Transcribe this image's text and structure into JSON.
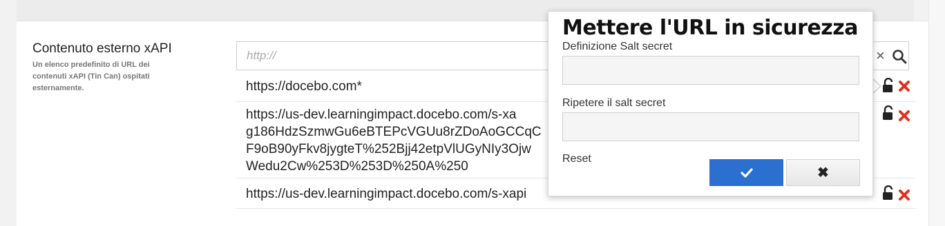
{
  "field": {
    "title": "Contenuto esterno xAPI",
    "description": "Un elenco predefinito di URL dei contenuti xAPI (Tin Can) ospitati esternamente."
  },
  "search": {
    "placeholder": "http://"
  },
  "urls": [
    {
      "text": "https://docebo.com*"
    },
    {
      "text": "https://us-dev.learningimpact.docebo.com/s-xa\ng186HdzSzmwGu6eBTEPcVGUu8rZDoAoGCCqC\nF9oB90yFkv8jygteT%252Bjj42etpVlUGyNIy3Ojw\nWedu2Cw%253D%253D%250A%250"
    },
    {
      "text": "https://us-dev.learningimpact.docebo.com/s-xapi"
    }
  ],
  "popup": {
    "title": "Mettere l'URL in sicurezza",
    "salt_label": "Definizione Salt secret",
    "repeat_label": "Ripetere il salt secret",
    "reset_label": "Reset",
    "ok_glyph": "✔",
    "cancel_glyph": "✖"
  },
  "colors": {
    "accent": "#2b6fd0",
    "delete": "#e0301e"
  }
}
